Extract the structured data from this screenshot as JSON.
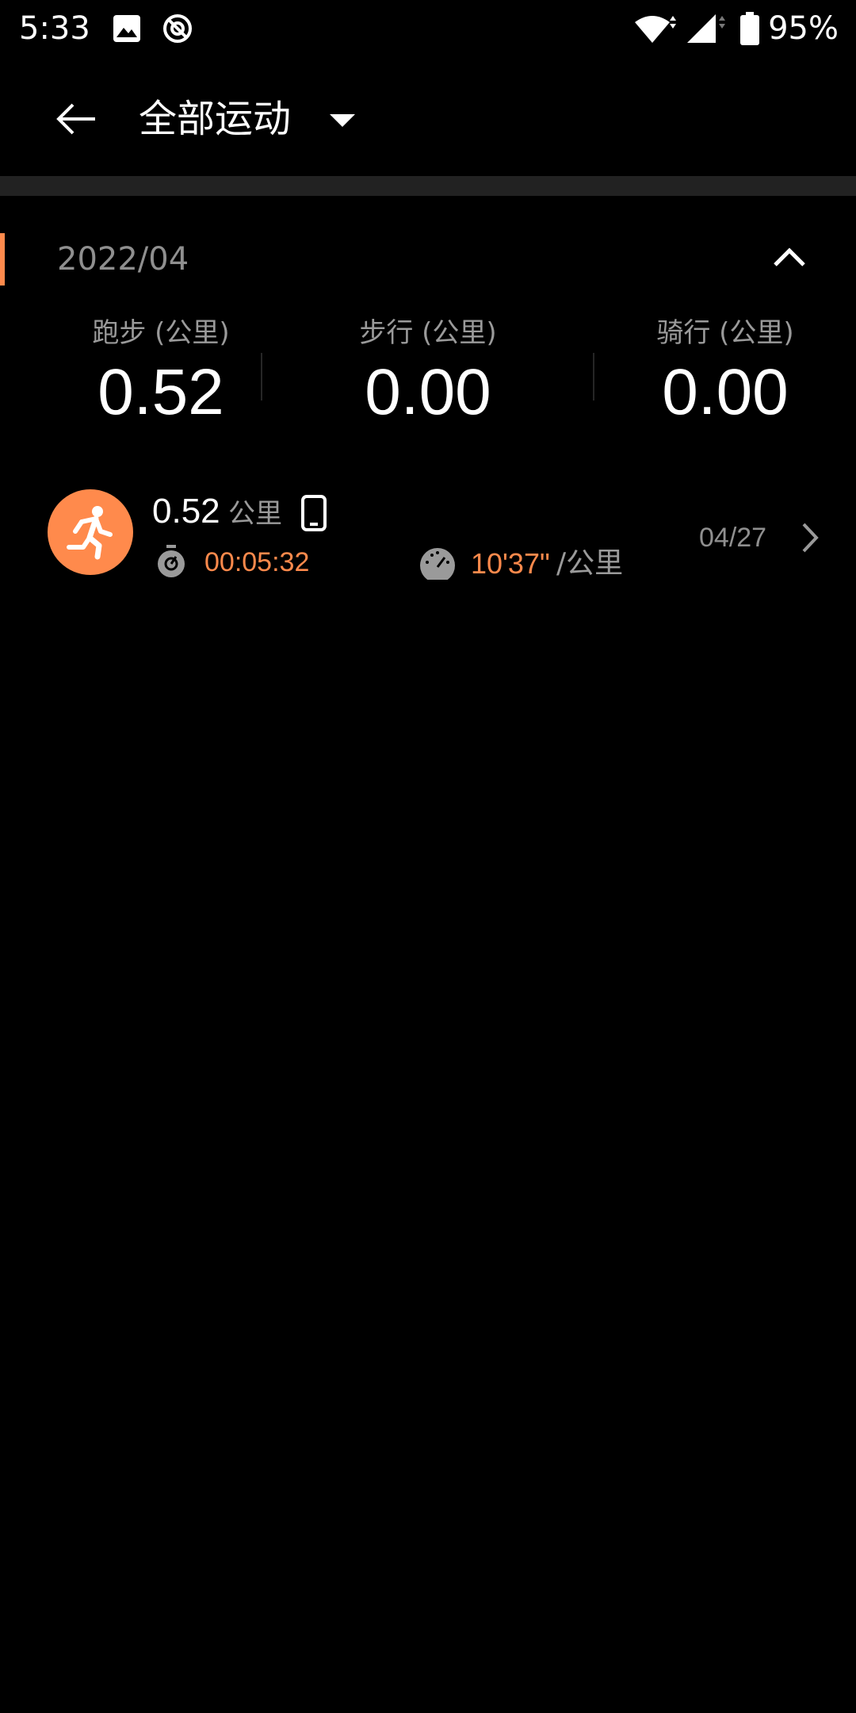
{
  "status_bar": {
    "time": "5:33",
    "battery_percent": "95%",
    "icons": [
      "image-icon",
      "sync-icon",
      "wifi-icon",
      "signal-icon",
      "battery-icon"
    ]
  },
  "toolbar": {
    "title": "全部运动",
    "icons": [
      "back-arrow-icon",
      "dropdown-triangle-icon"
    ]
  },
  "month": {
    "label": "2022/04",
    "accent_color": "#ff8a4c"
  },
  "summary": {
    "run": {
      "label": "跑步 (公里)",
      "value": "0.52"
    },
    "walk": {
      "label": "步行 (公里)",
      "value": "0.00"
    },
    "ride": {
      "label": "骑行 (公里)",
      "value": "0.00"
    }
  },
  "activities": [
    {
      "distance": "0.52",
      "unit": "公里",
      "duration": "00:05:32",
      "pace": "10'37\"",
      "pace_unit": "/公里",
      "date": "04/27",
      "icon": "running-icon",
      "device_icon": "phone-icon",
      "accent_color": "#ff8a4c"
    }
  ]
}
